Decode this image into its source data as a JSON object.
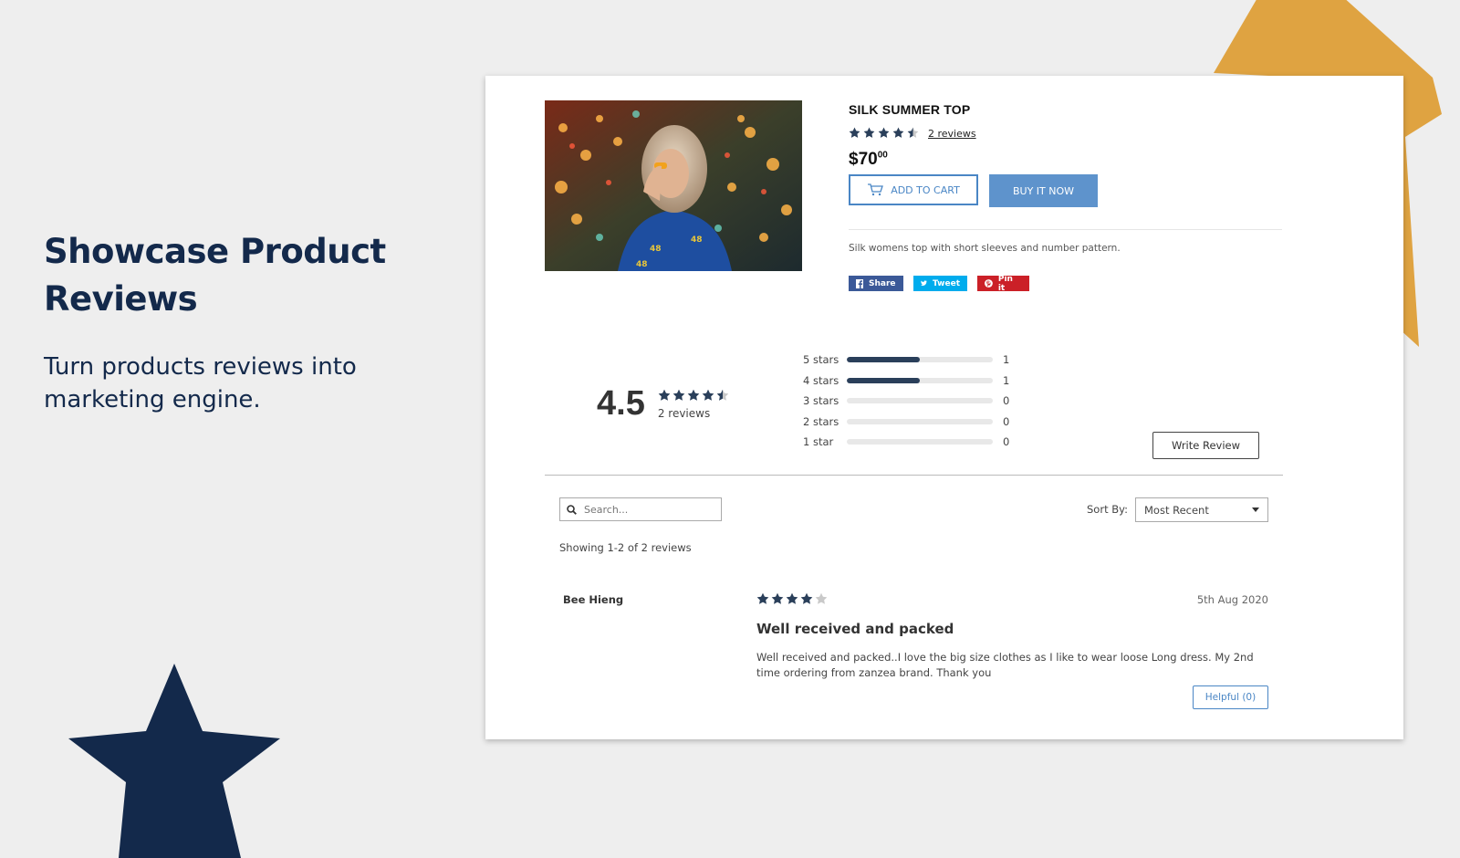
{
  "hero": {
    "title": "Showcase Product Reviews",
    "subtitle": "Turn products reviews into marketing engine."
  },
  "colors": {
    "navy": "#13294b",
    "gold": "#dfa341",
    "accent_blue": "#5e93cc",
    "star_fill": "#2a3f5a"
  },
  "product": {
    "title": "SILK SUMMER TOP",
    "rating": 4.5,
    "reviews_link": "2 reviews",
    "price_main": "$70",
    "price_cents": "00",
    "add_to_cart": "ADD TO CART",
    "buy_now": "BUY IT NOW",
    "description": "Silk womens top with short sleeves and number pattern.",
    "share": {
      "facebook": "Share",
      "twitter": "Tweet",
      "pinterest": "Pin it"
    }
  },
  "summary": {
    "average": "4.5",
    "count": "2 reviews",
    "histogram": [
      {
        "label": "5 stars",
        "count": "1",
        "fraction": 0.5
      },
      {
        "label": "4 stars",
        "count": "1",
        "fraction": 0.5
      },
      {
        "label": "3 stars",
        "count": "0",
        "fraction": 0
      },
      {
        "label": "2 stars",
        "count": "0",
        "fraction": 0
      },
      {
        "label": "1 star",
        "count": "0",
        "fraction": 0
      }
    ],
    "write_review": "Write Review"
  },
  "controls": {
    "search_placeholder": "Search...",
    "sort_label": "Sort By:",
    "sort_value": "Most Recent",
    "showing": "Showing 1-2 of 2 reviews"
  },
  "reviews": [
    {
      "author": "Bee Hieng",
      "rating": 4,
      "date": "5th Aug 2020",
      "title": "Well received and packed",
      "body": "Well received and packed..I love the big size clothes as I like to wear loose Long dress. My 2nd time ordering from zanzea brand. Thank you",
      "helpful": "Helpful (0)"
    }
  ]
}
